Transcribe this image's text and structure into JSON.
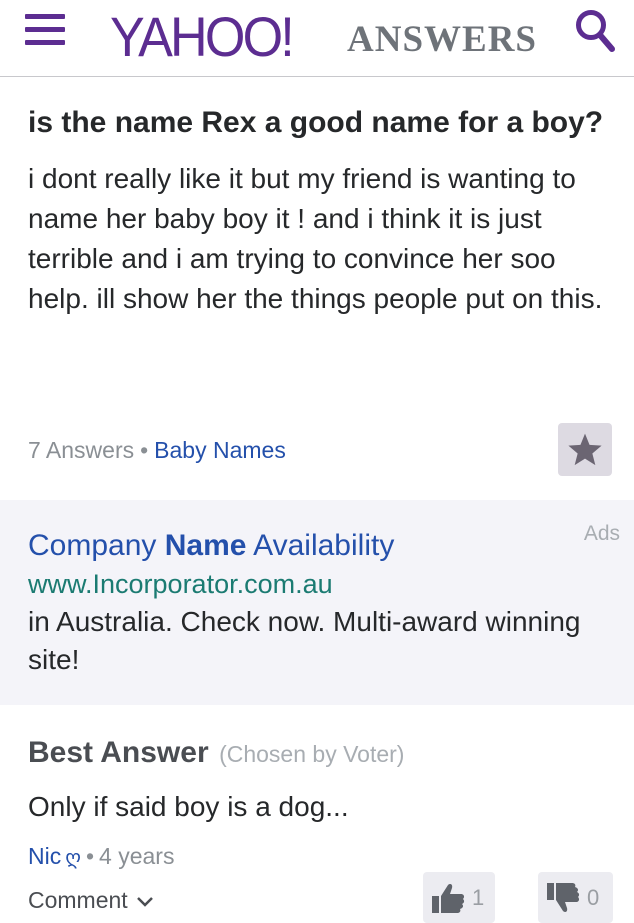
{
  "header": {
    "logo_main": "YAHOO!",
    "logo_sub": "ANSWERS",
    "brand_color": "#5c2d91",
    "menu_icon": "hamburger-menu-icon",
    "search_icon": "search-icon"
  },
  "question": {
    "title": "is the name Rex a good name for a boy?",
    "body": "i dont really like it but my friend is wanting to name her baby boy it ! and i think it is just terrible and i am trying to convince her soo help. ill show her the things people put on this.",
    "answers_count": "7 Answers",
    "separator": "•",
    "category": "Baby Names",
    "star_icon": "star-icon"
  },
  "ad": {
    "label": "Ads",
    "title_before": "Company ",
    "title_bold": "Name",
    "title_after": " Availability",
    "url": "www.Incorporator.com.au",
    "description": "in Australia. Check now. Multi-award winning site!"
  },
  "best_answer": {
    "heading": "Best Answer",
    "chosen_by": "(Chosen by Voter)",
    "text": "Only if said boy is a dog...",
    "author": "Nic",
    "author_glyph": "ღ",
    "separator": "•",
    "age": "4 years",
    "comment_label": "Comment",
    "thumbs_up_count": "1",
    "thumbs_down_count": "0"
  }
}
